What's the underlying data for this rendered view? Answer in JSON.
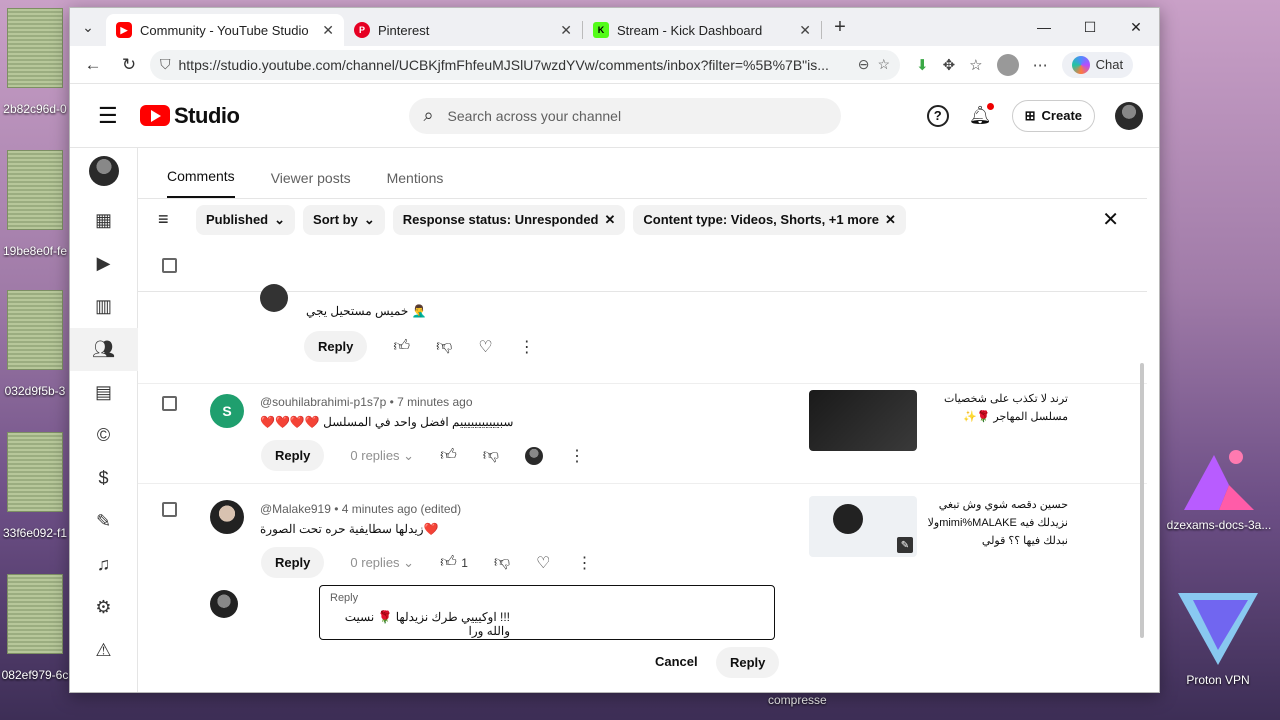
{
  "desktop": {
    "icons": [
      "2b82c96d-0",
      "19be8e0f-fe",
      "032d9f5b-3",
      "33f6e092-f1",
      "082ef979-6c"
    ],
    "right_icons": [
      "dzexams-docs-3a...",
      "Proton VPN"
    ],
    "compressed_label": "compresse"
  },
  "browser": {
    "tabs": [
      {
        "title": "Community - YouTube Studio"
      },
      {
        "title": "Pinterest"
      },
      {
        "title": "Stream - Kick Dashboard"
      }
    ],
    "url": "https://studio.youtube.com/channel/UCBKjfmFhfeuMJSlU7wzdYVw/comments/inbox?filter=%5B%7B\"is...",
    "copilot_label": "Chat"
  },
  "studio": {
    "logo_text": "Studio",
    "search_placeholder": "Search across your channel",
    "create_label": "Create",
    "content_tabs": [
      "Comments",
      "Viewer posts",
      "Mentions"
    ],
    "filters": [
      {
        "label": "Published"
      },
      {
        "label": "Sort by"
      },
      {
        "label": "Response status: Unresponded"
      },
      {
        "label": "Content type: Videos, Shorts, +1 more"
      }
    ],
    "comments": [
      {
        "text": "🤦‍♂️ خميس مستحيل يجي",
        "reply_label": "Reply"
      },
      {
        "author": "@souhilabrahimi-p1s7p",
        "time": "7 minutes ago",
        "avatar_letter": "S",
        "text": "سبيييييييييييم افضل واحد في المسلسل ❤️❤️❤️❤️",
        "reply_label": "Reply",
        "replies": "0 replies",
        "video_title": "ترند لا تكذب على شخصيات مسلسل المهاجر 🌹✨"
      },
      {
        "author": "@Malake919",
        "time": "4 minutes ago (edited)",
        "text": "❤️زيدلها سطايفية حره تحت الصورة",
        "reply_label": "Reply",
        "replies": "0 replies",
        "likes": "1",
        "video_title": "حسين دقصه شوي وش تبغي نزيدلك فيه mimi%MALAKEولا نبدلك فيها ؟؟ قولي"
      }
    ],
    "reply_box": {
      "label": "Reply",
      "value": "!!! اوكيييي طرك نزيدلها 🌹 نسيت والله ورا",
      "cancel": "Cancel",
      "submit": "Reply"
    }
  }
}
